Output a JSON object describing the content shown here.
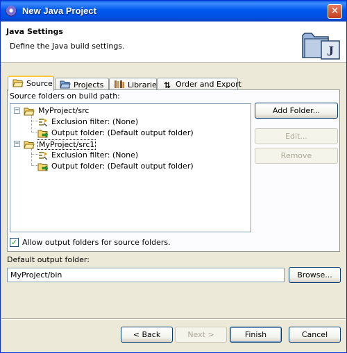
{
  "window": {
    "title": "New Java Project",
    "close_glyph": "✕"
  },
  "header": {
    "title": "Java Settings",
    "description": "Define the Java build settings.",
    "icon": "java-project-wizard-icon"
  },
  "tabs": [
    {
      "label": "Source",
      "icon": "source-folder-icon",
      "active": true
    },
    {
      "label": "Projects",
      "icon": "projects-icon",
      "active": false
    },
    {
      "label": "Libraries",
      "icon": "libraries-icon",
      "active": false
    },
    {
      "label": "Order and Export",
      "icon": "order-arrows-icon",
      "active": false
    }
  ],
  "source": {
    "label": "Source folders on build path:",
    "tree": [
      {
        "label": "MyProject/src",
        "children": [
          "Exclusion filter: (None)",
          "Output folder: (Default output folder)"
        ]
      },
      {
        "label": "MyProject/src1",
        "children": [
          "Exclusion filter: (None)",
          "Output folder: (Default output folder)"
        ]
      }
    ],
    "buttons": {
      "add_folder": "Add Folder...",
      "edit": "Edit...",
      "remove": "Remove"
    },
    "allow_output_label": "Allow output folders for source folders.",
    "allow_output_checked": true
  },
  "output": {
    "label": "Default output folder:",
    "value": "MyProject/bin",
    "browse": "Browse..."
  },
  "footer": {
    "back": "< Back",
    "next": "Next >",
    "finish": "Finish",
    "cancel": "Cancel"
  },
  "colors": {
    "titlebar": "#0058ee",
    "window_bg": "#ece9d8",
    "active_tab_accent": "#ffc83c"
  }
}
